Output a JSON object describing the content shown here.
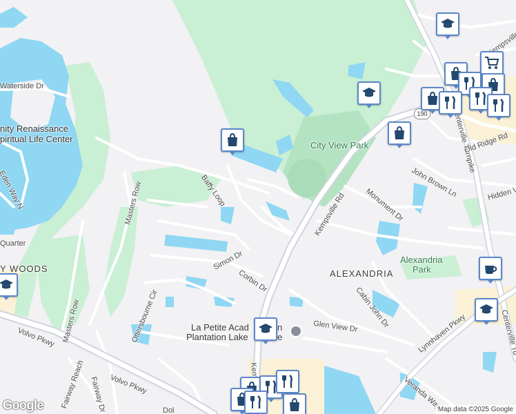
{
  "map": {
    "roads": {
      "waterside_dr": "Waterside Dr",
      "eden_way_n": "Eden Way N",
      "masters_row_1": "Masters Row",
      "masters_row_2": "Masters Row",
      "baffy_loop": "Baffy Loop",
      "simon_dr": "Simon Dr",
      "corbin_dr": "Corbin Dr",
      "kempsville_rd": "Kempsville Rd",
      "kempsville_rd_2": "Kem",
      "centerville_turnpike": "Centerville Turnpike",
      "centerville_tu": "Centerville Tu",
      "old_ridge_rd": "Old Ridge Rd",
      "john_brown_ln": "John Brown Ln",
      "hidden_va": "Hidden Va",
      "monument_dr": "Monument Dr",
      "cabin_john_dr": "Cabin John Dr",
      "glen_view_dr": "Glen View Dr",
      "lynnhaven_pkwy": "Lynnhaven Pkwy",
      "volvo_pkwy_1": "Volvo Pkwy",
      "volvo_pkwy_2": "Volvo Pkwy",
      "fairway_reach": "Fairway Reach",
      "fairway_dr": "Fairway Dr",
      "ottersbourne_cir": "Ottersbourne Cir",
      "veranda_way": "Veranda Way",
      "kempsville_top": "Kempsville",
      "quarter": "Quarter",
      "dol": "Dol"
    },
    "places": {
      "renaissance_1": "nity Renaissance",
      "renaissance_2": "piritual Life Center",
      "city_view_park": "City View Park",
      "alexandria": "ALEXANDRIA",
      "alexandria_park_1": "Alexandria",
      "alexandria_park_2": "Park",
      "woods": "Y WOODS",
      "la_petite_1": "La Petite Acad",
      "la_petite_2": "Plantation Lake",
      "la_petite_3": "n",
      "la_petite_4": "e"
    },
    "route_shield": "190",
    "attribution": "Map data ©2025 Google",
    "logo": "Google",
    "colors": {
      "land": "#f2f1f4",
      "park": "#c9efd4",
      "park_dark": "#b4e3c2",
      "water": "#8fd7f3",
      "road": "#ffffff",
      "major_road": "#cfd5dc",
      "commercial": "#fbf1d6",
      "pin_border": "#5b86c9",
      "pin_icon": "#23486e"
    },
    "pins": [
      {
        "name": "school-icon",
        "kind": "school"
      },
      {
        "name": "shopping-icon",
        "kind": "shop"
      },
      {
        "name": "school-icon",
        "kind": "school"
      },
      {
        "name": "shopping-icon",
        "kind": "shop"
      },
      {
        "name": "cafe-icon",
        "kind": "cafe"
      },
      {
        "name": "school-icon",
        "kind": "school"
      },
      {
        "name": "school-icon",
        "kind": "school"
      }
    ]
  }
}
